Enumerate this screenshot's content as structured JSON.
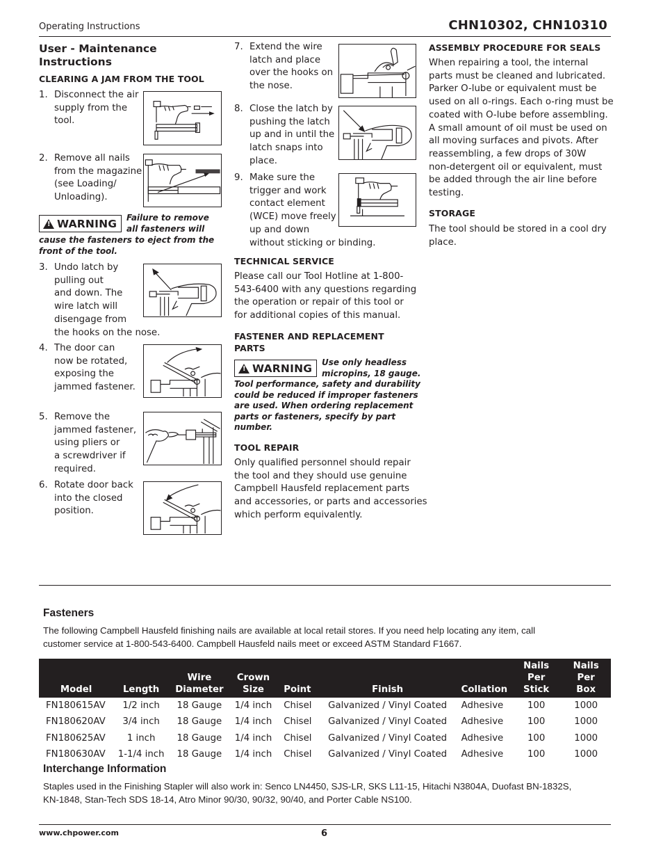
{
  "header": {
    "section_label": "Operating Instructions",
    "model_numbers": "CHN10302, CHN10310"
  },
  "maintenance": {
    "title_line1": "User - Maintenance",
    "title_line2": "Instructions",
    "jam_heading": "CLEARING A JAM FROM THE TOOL",
    "steps": [
      {
        "num": "1.",
        "lines": [
          "Disconnect the air",
          "supply from the",
          "tool."
        ],
        "figure": "disconnect-air-supply-illustration"
      },
      {
        "num": "2.",
        "lines": [
          "Remove all nails",
          "from the magazine",
          "(see Loading/",
          "Unloading)."
        ],
        "figure": "remove-nails-illustration"
      },
      {
        "num": "3.",
        "lines": [
          "Undo latch by",
          "pulling out",
          "and down. The",
          "wire latch will",
          "disengage from",
          "the hooks on the nose."
        ],
        "figure": "undo-latch-illustration"
      },
      {
        "num": "4.",
        "lines": [
          "The door can",
          "now be rotated,",
          "exposing the",
          "jammed fastener."
        ],
        "figure": "rotate-door-open-illustration"
      },
      {
        "num": "5.",
        "lines": [
          "Remove the",
          "jammed fastener,",
          "using pliers or",
          "a screwdriver if",
          "required."
        ],
        "figure": "remove-jammed-fastener-illustration"
      },
      {
        "num": "6.",
        "lines": [
          "Rotate door back",
          "into the closed",
          "position."
        ],
        "figure": "rotate-door-closed-illustration"
      },
      {
        "num": "7.",
        "lines": [
          "Extend the wire",
          "latch and place",
          "over the hooks on",
          "the nose."
        ],
        "figure": "extend-wire-latch-illustration"
      },
      {
        "num": "8.",
        "lines": [
          "Close the latch by",
          "pushing the latch",
          "up and in until the",
          "latch snaps into",
          "place."
        ],
        "figure": "close-latch-illustration"
      },
      {
        "num": "9.",
        "lines": [
          "Make sure the",
          "trigger and work",
          "contact element",
          "(WCE) move freely",
          "up and down",
          "without sticking or binding."
        ],
        "figure": "check-wce-illustration"
      }
    ],
    "warning_1": {
      "label": "WARNING",
      "lines": [
        "Failure to remove",
        "all fasteners will",
        "cause the fasteners to eject from the",
        "front of the tool."
      ]
    }
  },
  "technical_service": {
    "heading": "TECHNICAL SERVICE",
    "lines": [
      "Please call our Tool Hotline at 1-800-",
      "543-6400 with any questions regarding",
      "the operation or repair of this tool or",
      "for additional copies of this manual."
    ]
  },
  "fastener_parts": {
    "heading_line1": "FASTENER AND REPLACEMENT",
    "heading_line2": "PARTS",
    "warning": {
      "label": "WARNING",
      "lines": [
        "Use only headless",
        "micropins, 18 gauge.",
        "Tool performance, safety and durability",
        "could be reduced if improper fasteners",
        "are used. When ordering replacement",
        "parts or fasteners, specify by part",
        "number."
      ]
    }
  },
  "tool_repair": {
    "heading": "TOOL REPAIR",
    "lines": [
      "Only qualified personnel should repair",
      "the tool and they should use genuine",
      "Campbell Hausfeld replacement parts",
      "and accessories, or parts and accessories",
      "which perform equivalently."
    ]
  },
  "seals": {
    "heading": "ASSEMBLY PROCEDURE FOR SEALS",
    "lines": [
      "When repairing a tool, the internal",
      "parts must be cleaned and lubricated.",
      "Parker O-lube or equivalent must be",
      "used on all o-rings. Each o-ring must be",
      "coated with O-lube before assembling.",
      "A small amount of oil must be used on",
      "all moving surfaces and pivots. After",
      "reassembling, a few drops of 30W",
      "non-detergent oil or equivalent, must",
      "be added through the air line before",
      "testing."
    ]
  },
  "storage": {
    "heading": "STORAGE",
    "lines": [
      "The tool should be stored in a cool dry",
      "place."
    ]
  },
  "fasteners": {
    "heading": "Fasteners",
    "lines": [
      "The following Campbell Hausfeld finishing nails are available at local retail stores. If you need help locating any item, call",
      "customer service at 1-800-543-6400. Campbell Hausfeld nails meet or exceed ASTM Standard F1667."
    ],
    "table": {
      "columns": [
        {
          "line1": "",
          "line2": "Model"
        },
        {
          "line1": "",
          "line2": "Length"
        },
        {
          "line1": "Wire",
          "line2": "Diameter"
        },
        {
          "line1": "Crown",
          "line2": "Size"
        },
        {
          "line1": "",
          "line2": "Point"
        },
        {
          "line1": "",
          "line2": "Finish"
        },
        {
          "line1": "",
          "line2": "Collation"
        },
        {
          "line1": "Nails Per",
          "line2": "Stick"
        },
        {
          "line1": "Nails Per",
          "line2": "Box"
        }
      ],
      "rows": [
        [
          "FN180615AV",
          "1/2 inch",
          "18 Gauge",
          "1/4 inch",
          "Chisel",
          "Galvanized / Vinyl Coated",
          "Adhesive",
          "100",
          "1000"
        ],
        [
          "FN180620AV",
          "3/4 inch",
          "18 Gauge",
          "1/4 inch",
          "Chisel",
          "Galvanized / Vinyl Coated",
          "Adhesive",
          "100",
          "1000"
        ],
        [
          "FN180625AV",
          "1 inch",
          "18 Gauge",
          "1/4 inch",
          "Chisel",
          "Galvanized / Vinyl Coated",
          "Adhesive",
          "100",
          "1000"
        ],
        [
          "FN180630AV",
          "1-1/4 inch",
          "18 Gauge",
          "1/4 inch",
          "Chisel",
          "Galvanized / Vinyl Coated",
          "Adhesive",
          "100",
          "1000"
        ]
      ]
    }
  },
  "interchange": {
    "heading": "Interchange Information",
    "lines": [
      "Staples used in the Finishing Stapler will also work in: Senco LN4450, SJS-LR, SKS L11-15, Hitachi N3804A, Duofast BN-1832S,",
      "KN-1848, Stan-Tech SDS 18-14,  Atro Minor 90/30, 90/32, 90/40, and Porter Cable NS100."
    ]
  },
  "footer": {
    "website": "www.chpower.com",
    "page_number": "6"
  },
  "colors": {
    "text": "#231f20",
    "table_header_bg": "#231f20",
    "table_header_text": "#ffffff"
  }
}
